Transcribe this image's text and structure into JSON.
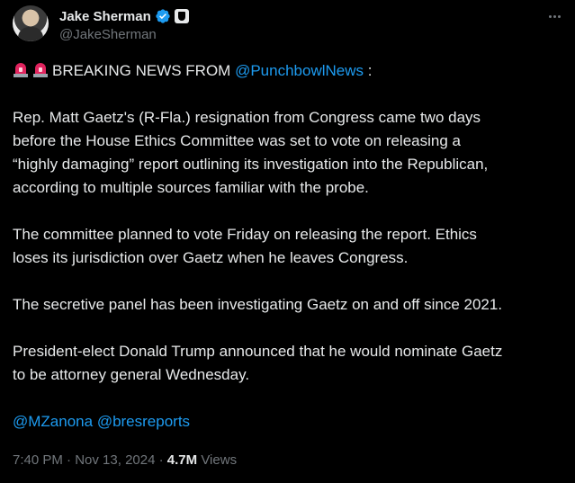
{
  "author": {
    "display_name": "Jake Sherman",
    "handle": "@JakeSherman"
  },
  "tweet": {
    "line1_prefix": "BREAKING NEWS FROM ",
    "line1_mention": "@PunchbowlNews",
    "line1_suffix": " :",
    "p1_l1": "Rep. Matt Gaetz's (R-Fla.) resignation from Congress came two days",
    "p1_l2": "before the House Ethics Committee was set to vote on releasing a",
    "p1_l3": "“highly damaging” report outlining its investigation into the Republican,",
    "p1_l4": "according to multiple sources familiar with the probe.",
    "p2_l1": "The committee planned to vote Friday on releasing the report. Ethics",
    "p2_l2": "loses its jurisdiction over Gaetz when he leaves Congress.",
    "p3_l1": "The secretive panel has been investigating Gaetz on and off since 2021.",
    "p4_l1": "President-elect Donald Trump announced that he would nominate Gaetz",
    "p4_l2": "to be attorney general Wednesday.",
    "mention1": "@MZanona",
    "mention2": "@bresreports"
  },
  "meta": {
    "time": "7:40 PM",
    "date": "Nov 13, 2024",
    "views_count": "4.7M",
    "views_label": "Views"
  },
  "icons": {
    "verified": "verified-badge-icon",
    "affiliate": "affiliate-badge-icon",
    "siren": "siren-emoji-icon",
    "more": "more-icon"
  },
  "colors": {
    "background": "#000000",
    "text": "#e7e9ea",
    "secondary": "#71767b",
    "link": "#1d9bf0"
  }
}
